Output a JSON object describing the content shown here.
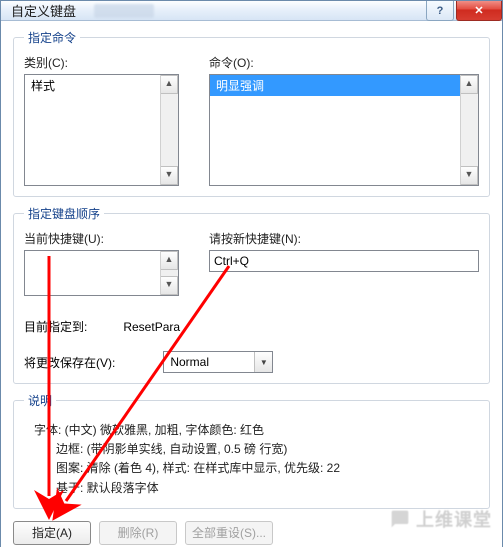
{
  "titlebar": {
    "title": "自定义键盘"
  },
  "fs1_legend": "指定命令",
  "labels": {
    "category": "类别(C):",
    "command": "命令(O):",
    "current_keys": "当前快捷键(U):",
    "press_new": "请按新快捷键(N):",
    "currently_assigned_prefix": "目前指定到:",
    "currently_assigned_value": "ResetPara",
    "save_in_prefix": "将更改保存在(V):"
  },
  "category_list": {
    "selected": "样式"
  },
  "command_list": {
    "selected": "明显强调"
  },
  "fs2_legend": "指定键盘顺序",
  "new_shortcut_value": "Ctrl+Q",
  "save_in_combo": {
    "value": "Normal"
  },
  "fs3_legend": "说明",
  "description_lines": [
    "字体: (中文) 微软雅黑, 加粗, 字体颜色: 红色",
    "边框: (带阴影单实线, 自动设置,  0.5 磅 行宽)",
    "图案: 清除 (着色 4), 样式: 在样式库中显示, 优先级: 22",
    "基于: 默认段落字体"
  ],
  "buttons": {
    "assign": "指定(A)",
    "remove": "删除(R)",
    "reset_all": "全部重设(S)..."
  },
  "watermark": {
    "text": "上维课堂"
  }
}
